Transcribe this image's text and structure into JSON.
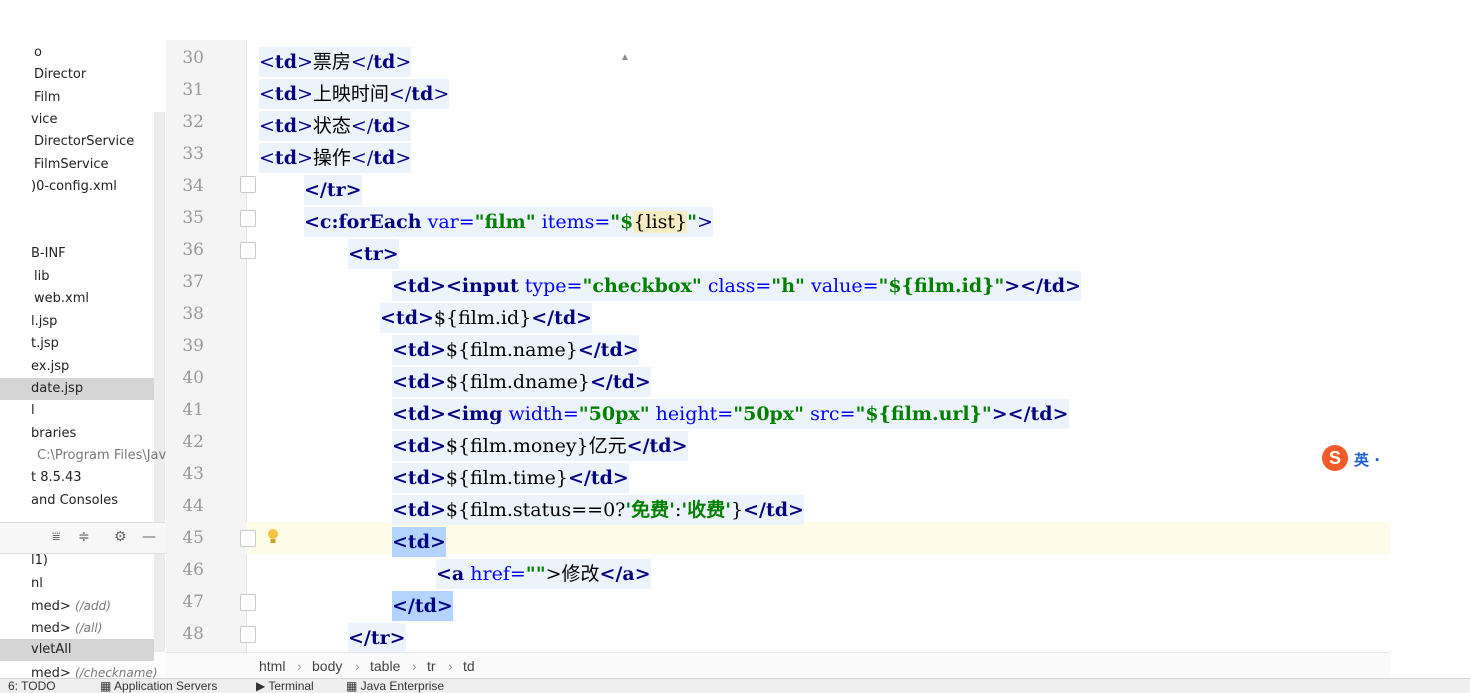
{
  "project": {
    "items": [
      {
        "text": "o"
      },
      {
        "text": "Director"
      },
      {
        "text": "Film"
      },
      {
        "text": "vice"
      },
      {
        "text": "DirectorService"
      },
      {
        "text": "FilmService"
      },
      {
        "text": ")0-config.xml"
      },
      {
        "text": "B-INF"
      },
      {
        "text": "lib"
      },
      {
        "text": "web.xml"
      },
      {
        "text": "l.jsp"
      },
      {
        "text": "t.jsp"
      },
      {
        "text": "ex.jsp"
      },
      {
        "text": "date.jsp"
      },
      {
        "text": "l"
      },
      {
        "text": "braries"
      },
      {
        "text": "C:\\Program Files\\Java"
      },
      {
        "text": "t 8.5.43"
      },
      {
        "text": "and Consoles"
      }
    ],
    "servlets": [
      {
        "name": "l1)",
        "hint": ""
      },
      {
        "name": "nl",
        "hint": ""
      },
      {
        "name": "med>",
        "hint": "(/add)"
      },
      {
        "name": "med>",
        "hint": "(/all)"
      },
      {
        "name": "vletAll",
        "hint": ""
      },
      {
        "name": "med>",
        "hint": "(/checkname)"
      }
    ]
  },
  "editor": {
    "line_numbers": [
      "30",
      "31",
      "32",
      "33",
      "34",
      "35",
      "36",
      "37",
      "38",
      "39",
      "40",
      "41",
      "42",
      "43",
      "44",
      "45",
      "46",
      "47",
      "48"
    ],
    "l30": {
      "open": "<",
      "tag": "td",
      "close": ">",
      "text": "票房",
      "etag": "</",
      "etag2": "td",
      "eclose": ">"
    },
    "l31": {
      "text": "上映时间"
    },
    "l32": {
      "text": "状态"
    },
    "l33": {
      "text": "操作"
    },
    "l34": {
      "text": "</tr>"
    },
    "l35": {
      "a": "<c:forEach",
      "b": " var=",
      "c": "\"film\"",
      "d": " items=",
      "e": "\"$",
      "f": "{list}",
      "g": "\"",
      "h": ">"
    },
    "l36": {
      "text": "<tr>"
    },
    "l37": {
      "a": "<td><input",
      "b": " type=",
      "c": "\"checkbox\"",
      "d": " class=",
      "e": "\"h\"",
      "f": " value=",
      "g": "\"${film.id}\"",
      "h": "></td>"
    },
    "l38": {
      "a": "<td>",
      "b": "${film.id}",
      "c": "</td>"
    },
    "l39": {
      "a": "<td>",
      "b": "${film.name}",
      "c": "</td>"
    },
    "l40": {
      "a": "<td>",
      "b": "${film.dname}",
      "c": "</td>"
    },
    "l41": {
      "a": "<td><img",
      "b": " width=",
      "c": "\"50px\"",
      "d": " height=",
      "e": "\"50px\"",
      "f": " src=",
      "g": "\"${film.url}\"",
      "h": "></td>"
    },
    "l42": {
      "a": "<td>",
      "b": "${film.money}亿元",
      "c": "</td>"
    },
    "l43": {
      "a": "<td>",
      "b": "${film.time}",
      "c": "</td>"
    },
    "l44": {
      "a": "<td>",
      "b": "${film.status==0?",
      "c": "'免费'",
      ":": ":",
      "d": "'收费'",
      "e": "}",
      "f": "</td>"
    },
    "l45": {
      "text": "<td>"
    },
    "l46": {
      "a": "<a",
      "b": " href=",
      "c": "\"\"",
      "d": ">修改",
      "e": "</a>"
    },
    "l47": {
      "text": "</td>"
    },
    "l48": {
      "text": "</tr>"
    }
  },
  "breadcrumb": [
    "html",
    "body",
    "table",
    "tr",
    "td"
  ],
  "bottom_bar": [
    "6: TODO",
    "Application Servers",
    "Terminal",
    "Java Enterprise"
  ],
  "ime": {
    "logo": "S",
    "label": "英 ·"
  }
}
